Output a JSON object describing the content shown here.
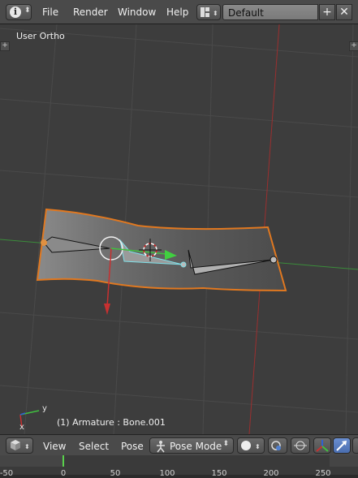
{
  "topbar": {
    "menu": [
      "File",
      "Render",
      "Window",
      "Help"
    ],
    "screen_layout": "Default"
  },
  "viewport": {
    "view_label": "User Ortho",
    "status": "(1) Armature : Bone.001",
    "axis_y": "y",
    "axis_x": "x",
    "colors": {
      "background": "#3d3d3d",
      "grid": "#4a4a4a",
      "x_axis": "#9b2f2f",
      "y_axis": "#3b8d3b",
      "mesh": "#e07820",
      "bone_active": "#7fe0e8"
    }
  },
  "bottombar": {
    "menu": [
      "View",
      "Select",
      "Pose"
    ],
    "mode": "Pose Mode"
  },
  "timeline": {
    "ticks": [
      "-50",
      "0",
      "50",
      "100",
      "150",
      "200",
      "250"
    ],
    "current_frame": 1
  }
}
